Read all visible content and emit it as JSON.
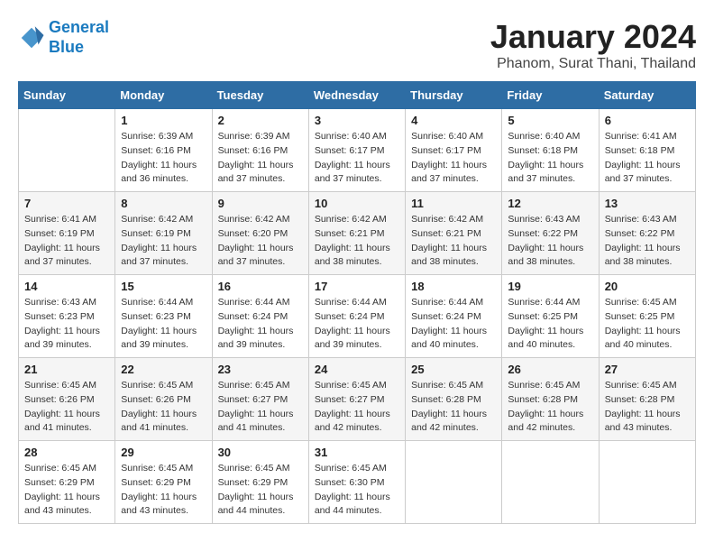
{
  "logo": {
    "line1": "General",
    "line2": "Blue"
  },
  "header": {
    "month": "January 2024",
    "location": "Phanom, Surat Thani, Thailand"
  },
  "columns": [
    "Sunday",
    "Monday",
    "Tuesday",
    "Wednesday",
    "Thursday",
    "Friday",
    "Saturday"
  ],
  "weeks": [
    [
      {
        "day": "",
        "info": ""
      },
      {
        "day": "1",
        "info": "Sunrise: 6:39 AM\nSunset: 6:16 PM\nDaylight: 11 hours and 36 minutes."
      },
      {
        "day": "2",
        "info": "Sunrise: 6:39 AM\nSunset: 6:16 PM\nDaylight: 11 hours and 37 minutes."
      },
      {
        "day": "3",
        "info": "Sunrise: 6:40 AM\nSunset: 6:17 PM\nDaylight: 11 hours and 37 minutes."
      },
      {
        "day": "4",
        "info": "Sunrise: 6:40 AM\nSunset: 6:17 PM\nDaylight: 11 hours and 37 minutes."
      },
      {
        "day": "5",
        "info": "Sunrise: 6:40 AM\nSunset: 6:18 PM\nDaylight: 11 hours and 37 minutes."
      },
      {
        "day": "6",
        "info": "Sunrise: 6:41 AM\nSunset: 6:18 PM\nDaylight: 11 hours and 37 minutes."
      }
    ],
    [
      {
        "day": "7",
        "info": "Sunrise: 6:41 AM\nSunset: 6:19 PM\nDaylight: 11 hours and 37 minutes."
      },
      {
        "day": "8",
        "info": "Sunrise: 6:42 AM\nSunset: 6:19 PM\nDaylight: 11 hours and 37 minutes."
      },
      {
        "day": "9",
        "info": "Sunrise: 6:42 AM\nSunset: 6:20 PM\nDaylight: 11 hours and 37 minutes."
      },
      {
        "day": "10",
        "info": "Sunrise: 6:42 AM\nSunset: 6:21 PM\nDaylight: 11 hours and 38 minutes."
      },
      {
        "day": "11",
        "info": "Sunrise: 6:42 AM\nSunset: 6:21 PM\nDaylight: 11 hours and 38 minutes."
      },
      {
        "day": "12",
        "info": "Sunrise: 6:43 AM\nSunset: 6:22 PM\nDaylight: 11 hours and 38 minutes."
      },
      {
        "day": "13",
        "info": "Sunrise: 6:43 AM\nSunset: 6:22 PM\nDaylight: 11 hours and 38 minutes."
      }
    ],
    [
      {
        "day": "14",
        "info": "Sunrise: 6:43 AM\nSunset: 6:23 PM\nDaylight: 11 hours and 39 minutes."
      },
      {
        "day": "15",
        "info": "Sunrise: 6:44 AM\nSunset: 6:23 PM\nDaylight: 11 hours and 39 minutes."
      },
      {
        "day": "16",
        "info": "Sunrise: 6:44 AM\nSunset: 6:24 PM\nDaylight: 11 hours and 39 minutes."
      },
      {
        "day": "17",
        "info": "Sunrise: 6:44 AM\nSunset: 6:24 PM\nDaylight: 11 hours and 39 minutes."
      },
      {
        "day": "18",
        "info": "Sunrise: 6:44 AM\nSunset: 6:24 PM\nDaylight: 11 hours and 40 minutes."
      },
      {
        "day": "19",
        "info": "Sunrise: 6:44 AM\nSunset: 6:25 PM\nDaylight: 11 hours and 40 minutes."
      },
      {
        "day": "20",
        "info": "Sunrise: 6:45 AM\nSunset: 6:25 PM\nDaylight: 11 hours and 40 minutes."
      }
    ],
    [
      {
        "day": "21",
        "info": "Sunrise: 6:45 AM\nSunset: 6:26 PM\nDaylight: 11 hours and 41 minutes."
      },
      {
        "day": "22",
        "info": "Sunrise: 6:45 AM\nSunset: 6:26 PM\nDaylight: 11 hours and 41 minutes."
      },
      {
        "day": "23",
        "info": "Sunrise: 6:45 AM\nSunset: 6:27 PM\nDaylight: 11 hours and 41 minutes."
      },
      {
        "day": "24",
        "info": "Sunrise: 6:45 AM\nSunset: 6:27 PM\nDaylight: 11 hours and 42 minutes."
      },
      {
        "day": "25",
        "info": "Sunrise: 6:45 AM\nSunset: 6:28 PM\nDaylight: 11 hours and 42 minutes."
      },
      {
        "day": "26",
        "info": "Sunrise: 6:45 AM\nSunset: 6:28 PM\nDaylight: 11 hours and 42 minutes."
      },
      {
        "day": "27",
        "info": "Sunrise: 6:45 AM\nSunset: 6:28 PM\nDaylight: 11 hours and 43 minutes."
      }
    ],
    [
      {
        "day": "28",
        "info": "Sunrise: 6:45 AM\nSunset: 6:29 PM\nDaylight: 11 hours and 43 minutes."
      },
      {
        "day": "29",
        "info": "Sunrise: 6:45 AM\nSunset: 6:29 PM\nDaylight: 11 hours and 43 minutes."
      },
      {
        "day": "30",
        "info": "Sunrise: 6:45 AM\nSunset: 6:29 PM\nDaylight: 11 hours and 44 minutes."
      },
      {
        "day": "31",
        "info": "Sunrise: 6:45 AM\nSunset: 6:30 PM\nDaylight: 11 hours and 44 minutes."
      },
      {
        "day": "",
        "info": ""
      },
      {
        "day": "",
        "info": ""
      },
      {
        "day": "",
        "info": ""
      }
    ]
  ]
}
